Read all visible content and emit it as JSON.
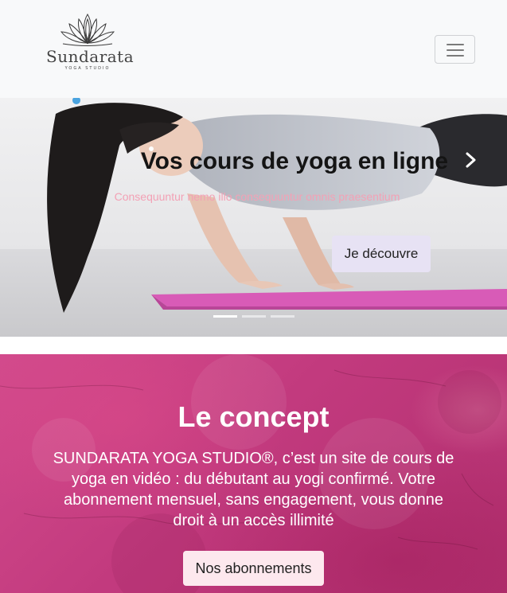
{
  "navbar": {
    "brand_name": "Sundarata",
    "brand_subtitle": "YOGA STUDIO",
    "toggler_icon": "hamburger-menu-icon"
  },
  "carousel": {
    "title": "Vos cours de yoga en ligne",
    "text": "Consequuntur nemo illo consequuntur omnis praesentium",
    "button_label": "Je découvre",
    "next_icon": "chevron-right-icon",
    "slide_count": 3,
    "active_slide": 1
  },
  "concept": {
    "title": "Le concept",
    "text": "SUNDARATA YOGA STUDIO®, c’est un site de cours de yoga en vidéo : du débutant au yogi confirmé. Votre abonnement mensuel, sans engagement, vous donne droit à un accès illimité",
    "button_label": "Nos abonnements"
  },
  "colors": {
    "navbar_bg": "#f8f9fa",
    "concept_bg": "#c23a7e",
    "caption_text": "#f3a1b5",
    "button_decouvre": "#e7e2f4",
    "button_abonnements": "#fde8ee"
  }
}
